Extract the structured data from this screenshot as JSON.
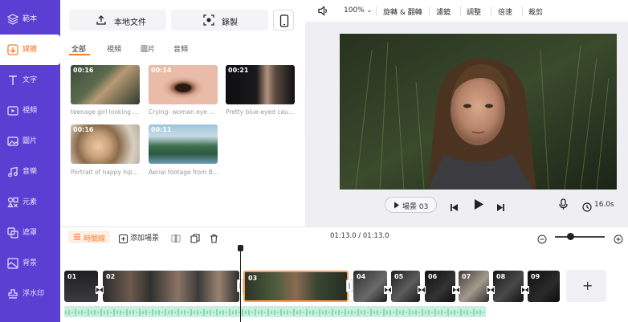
{
  "sidebar": {
    "items": [
      {
        "label": "範本",
        "icon": "layers-icon"
      },
      {
        "label": "媒體",
        "icon": "media-upload-icon"
      },
      {
        "label": "文字",
        "icon": "text-icon"
      },
      {
        "label": "視頻",
        "icon": "video-icon"
      },
      {
        "label": "圖片",
        "icon": "image-icon"
      },
      {
        "label": "音樂",
        "icon": "music-icon"
      },
      {
        "label": "元素",
        "icon": "elements-icon"
      },
      {
        "label": "遮罩",
        "icon": "overlay-icon"
      },
      {
        "label": "背景",
        "icon": "background-icon"
      },
      {
        "label": "浮水印",
        "icon": "watermark-icon"
      }
    ],
    "active_index": 1
  },
  "media_panel": {
    "upload_label": "本地文件",
    "record_label": "錄製",
    "tabs": [
      "全部",
      "視頻",
      "圖片",
      "音頻"
    ],
    "active_tab": 0,
    "items": [
      {
        "duration": "00:16",
        "caption": "teenage girl looking sad ..."
      },
      {
        "duration": "00:14",
        "caption": "Crying- woman eye with ..."
      },
      {
        "duration": "00:21",
        "caption": "Pretty blue-eyed caucasi..."
      },
      {
        "duration": "00:16",
        "caption": "Portrait of happy hipster ..."
      },
      {
        "duration": "00:11",
        "caption": "Aerial footage from Bea..."
      }
    ]
  },
  "toolbar": {
    "zoom": "100%",
    "items": [
      "旋轉 & 翻轉",
      "濾鏡",
      "調整",
      "倍速",
      "裁剪"
    ]
  },
  "preview": {
    "scene_label": "場景 03",
    "total_duration": "16.0s"
  },
  "timeline": {
    "tab_label": "時間線",
    "add_scene_label": "添加場景",
    "time_display": "01:13.0 / 01:13.0",
    "zoom_level": 0.3,
    "clips": [
      "01",
      "02",
      "03",
      "04",
      "05",
      "06",
      "07",
      "08",
      "09"
    ],
    "selected_clip": "03",
    "add_button": "+"
  },
  "colors": {
    "sidebar": "#5a3fd2",
    "accent": "#ff7a2f",
    "audio_track": "#c9f0de"
  }
}
